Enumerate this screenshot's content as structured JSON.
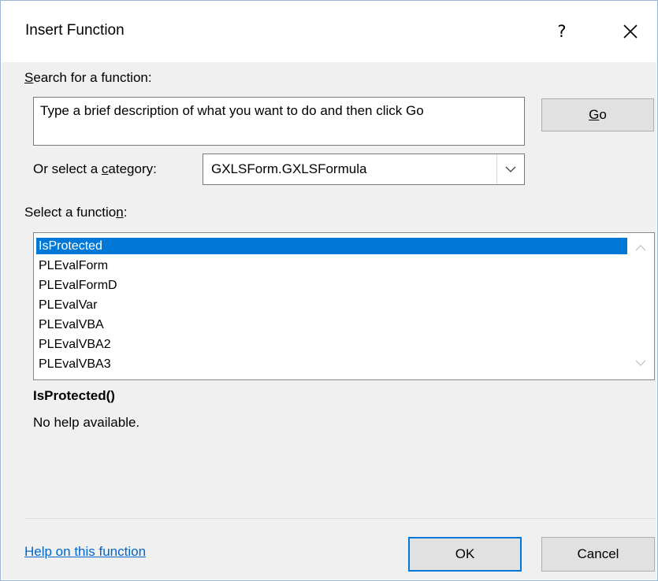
{
  "window": {
    "title": "Insert Function",
    "help_label": "?"
  },
  "search": {
    "label_pre": "",
    "label_accel": "S",
    "label_post": "earch for a function:",
    "value": "Type a brief description of what you want to do and then click Go",
    "go_accel": "G",
    "go_post": "o"
  },
  "category": {
    "label_pre": "Or select a ",
    "label_accel": "c",
    "label_post": "ategory:",
    "selected": "GXLSForm.GXLSFormula"
  },
  "functions": {
    "label_pre": "Select a functio",
    "label_accel": "n",
    "label_post": ":",
    "items": [
      "IsProtected",
      "PLEvalForm",
      "PLEvalFormD",
      "PLEvalVar",
      "PLEvalVBA",
      "PLEvalVBA2",
      "PLEvalVBA3"
    ],
    "selected_index": 0
  },
  "details": {
    "signature": "IsProtected()",
    "description": "No help available."
  },
  "footer": {
    "help_link": "Help on this function",
    "ok_label": "OK",
    "cancel_label": "Cancel"
  },
  "colors": {
    "accent": "#0078d7",
    "link": "#0066cc",
    "dialog_bg": "#f0f0f0"
  }
}
